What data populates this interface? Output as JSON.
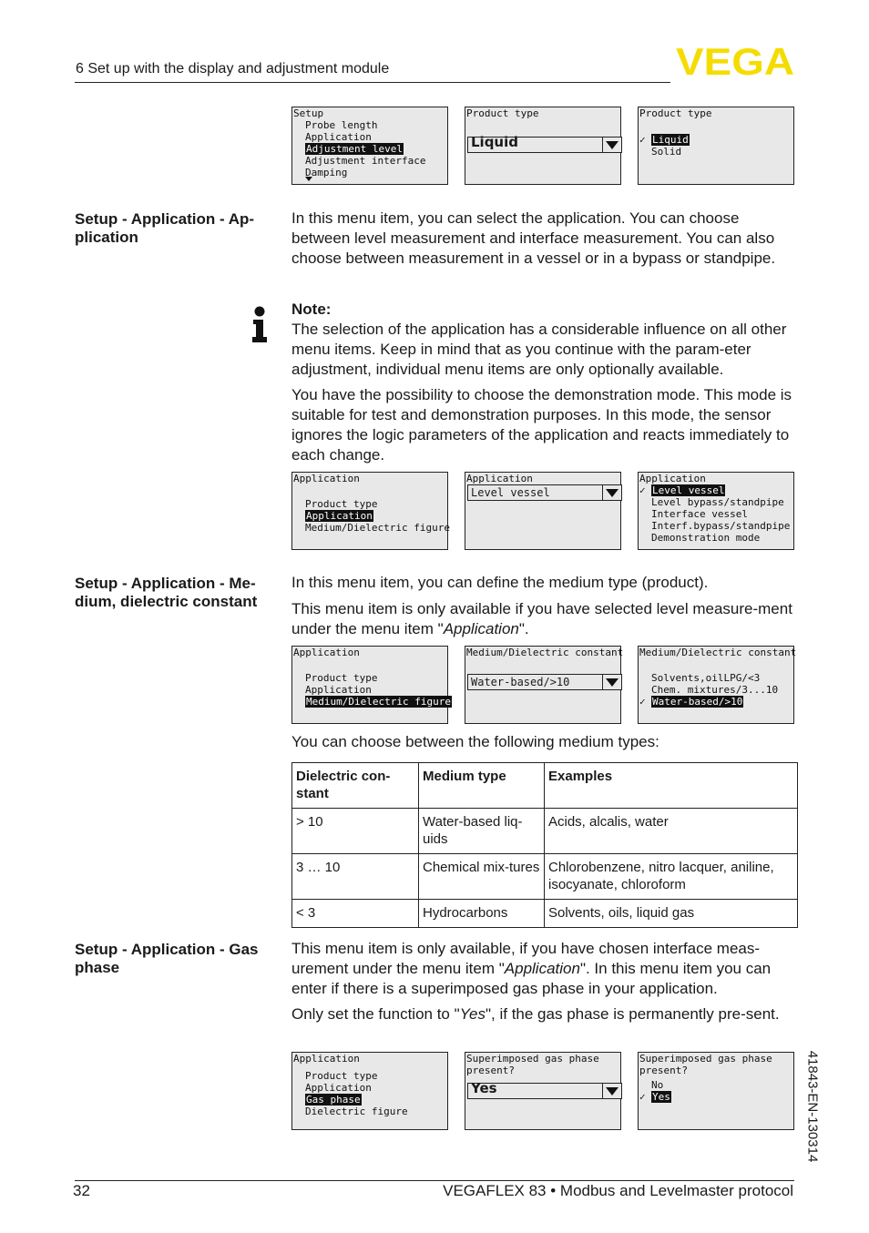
{
  "header": {
    "chapter": "6 Set up with the display and adjustment module",
    "logo_text": "VEGA",
    "logo_color": "#f5dc00"
  },
  "footer": {
    "page_number": "32",
    "doc_title": "VEGAFLEX 83 • Modbus and Levelmaster protocol",
    "doc_code": "41843-EN-130314"
  },
  "screens_row1": {
    "setup_menu": {
      "title": "Setup",
      "items": [
        "Probe length",
        "Application",
        "Adjustment level",
        "Adjustment interface",
        "Damping"
      ],
      "selected": "Adjustment level"
    },
    "product_type_select": {
      "title": "Product type",
      "value": "Liquid"
    },
    "product_type_list": {
      "title": "Product type",
      "options": [
        "Liquid",
        "Solid"
      ],
      "checked": "Liquid"
    }
  },
  "section_application": {
    "label": "Setup - Application - Ap-plication",
    "label_line1": "Setup - Application - Ap-",
    "label_line2": "plication",
    "text": "In this menu item, you can select the application. You can choose between level measurement and interface measurement. You can also choose between measurement in a vessel or in a bypass or standpipe.",
    "note_title": "Note:",
    "note_text": "The selection of the application has a considerable influence on all other menu items. Keep in mind that as you continue with the param-eter adjustment, individual menu items are only optionally available.",
    "demo_text": "You have the possibility to choose the demonstration mode. This mode is suitable for test and demonstration purposes. In this mode, the sensor ignores the logic parameters of the application and reacts immediately to each change."
  },
  "screens_row2": {
    "app_menu": {
      "title": "Application",
      "items": [
        "Product type",
        "Application",
        "Medium/Dielectric figure"
      ],
      "selected": "Application"
    },
    "app_select": {
      "title": "Application",
      "value": "Level vessel"
    },
    "app_list": {
      "title": "Application",
      "options": [
        "Level vessel",
        "Level bypass/standpipe",
        "Interface vessel",
        "Interf.bypass/standpipe",
        "Demonstration mode"
      ],
      "checked": "Level vessel"
    }
  },
  "section_medium": {
    "label_line1": "Setup - Application - Me-",
    "label_line2": "dium, dielectric constant",
    "text1": "In this menu item, you can define the medium type (product).",
    "text2_prefix": "This menu item is only available if you have selected level measure-ment under the menu item \"",
    "text2_italic": "Application",
    "text2_suffix": "\".",
    "table_intro": "You can choose between the following medium types:"
  },
  "screens_row3": {
    "app_menu": {
      "title": "Application",
      "items": [
        "Product type",
        "Application",
        "Medium/Dielectric figure"
      ],
      "selected": "Medium/Dielectric figure"
    },
    "medium_select": {
      "title": "Medium/Dielectric constant",
      "value": "Water-based/>10"
    },
    "medium_list": {
      "title": "Medium/Dielectric constant",
      "options": [
        "Solvents,oilLPG/<3",
        "Chem. mixtures/3...10",
        "Water-based/>10"
      ],
      "checked": "Water-based/>10"
    }
  },
  "medium_table": {
    "headers": [
      "Dielectric con-stant",
      "Medium type",
      "Examples"
    ],
    "rows": [
      [
        "> 10",
        "Water-based liq-uids",
        "Acids, alcalis, water"
      ],
      [
        "3 … 10",
        "Chemical mix-tures",
        "Chlorobenzene, nitro lacquer, aniline, isocyanate, chloroform"
      ],
      [
        "< 3",
        "Hydrocarbons",
        "Solvents, oils, liquid gas"
      ]
    ]
  },
  "section_gas": {
    "label_line1": "Setup - Application - Gas",
    "label_line2": "phase",
    "text1_prefix": "This menu item is only available, if you have chosen interface meas-urement under the menu item \"",
    "text1_italic": "Application",
    "text1_suffix": "\". In this menu item you can enter if there is a superimposed gas phase in your application.",
    "text2_prefix": "Only set the function to \"",
    "text2_italic": "Yes",
    "text2_suffix": "\", if the gas phase is permanently pre-sent."
  },
  "screens_row4": {
    "app_menu": {
      "title": "Application",
      "items": [
        "Product type",
        "Application",
        "Gas phase",
        "Dielectric figure"
      ],
      "selected": "Gas phase"
    },
    "gas_select": {
      "title_line1": "Superimposed gas phase",
      "title_line2": "present?",
      "value": "Yes"
    },
    "gas_list": {
      "title_line1": "Superimposed gas phase",
      "title_line2": "present?",
      "options": [
        "No",
        "Yes"
      ],
      "checked": "Yes"
    }
  }
}
